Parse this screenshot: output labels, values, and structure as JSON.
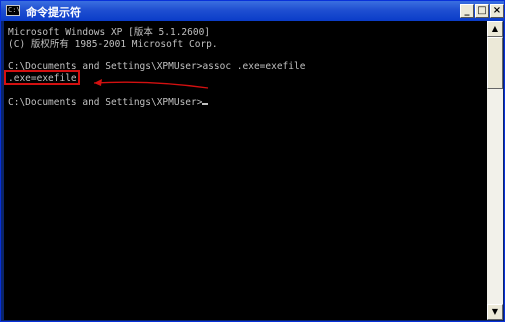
{
  "window": {
    "title": "命令提示符",
    "icon_label": "C:\\",
    "minimize_label": "_",
    "maximize_label": "□",
    "close_label": "×"
  },
  "console": {
    "lines": [
      "Microsoft Windows XP [版本 5.1.2600]",
      "(C) 版权所有 1985-2001 Microsoft Corp.",
      "",
      "C:\\Documents and Settings\\XPMUser>assoc .exe=exefile",
      ".exe=exefile",
      "",
      "C:\\Documents and Settings\\XPMUser>"
    ]
  },
  "scrollbar": {
    "up_label": "▲",
    "down_label": "▼"
  },
  "annotation": {
    "highlight_color": "#d41010",
    "arrow_color": "#d41010"
  }
}
